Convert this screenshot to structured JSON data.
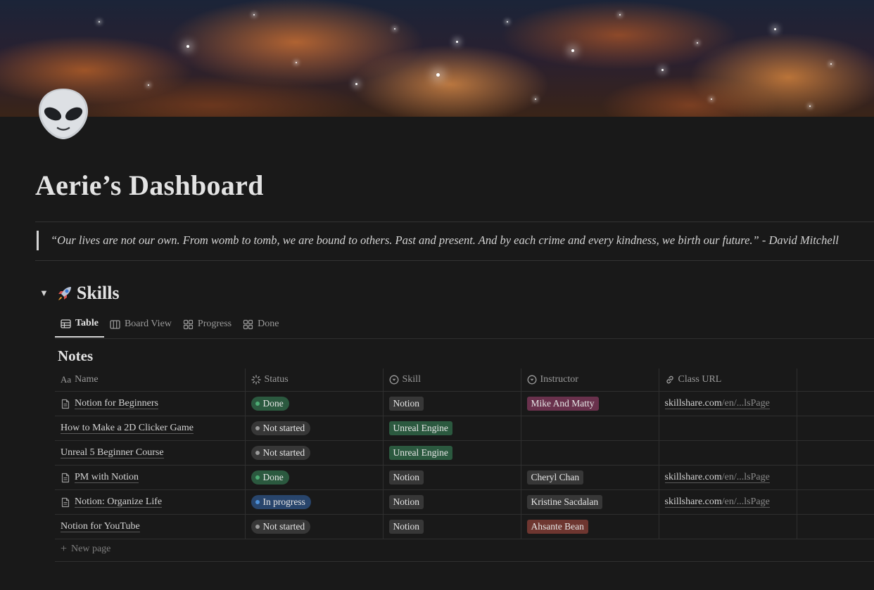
{
  "page": {
    "title": "Aerie’s Dashboard",
    "quote": "“Our lives are not our own.  From womb to tomb, we are bound to others.  Past and present.  And by each crime and every kindness, we birth our future.” - David Mitchell"
  },
  "section": {
    "title": "Skills",
    "icon": "rocket-icon"
  },
  "tabs": [
    {
      "label": "Table",
      "icon": "table-icon"
    },
    {
      "label": "Board View",
      "icon": "board-icon"
    },
    {
      "label": "Progress",
      "icon": "gallery-icon"
    },
    {
      "label": "Done",
      "icon": "gallery-icon"
    }
  ],
  "database": {
    "title": "Notes",
    "columns": [
      {
        "label": "Name",
        "icon": "text-aa-icon"
      },
      {
        "label": "Status",
        "icon": "status-icon"
      },
      {
        "label": "Skill",
        "icon": "select-icon"
      },
      {
        "label": "Instructor",
        "icon": "select-icon"
      },
      {
        "label": "Class URL",
        "icon": "link-icon"
      }
    ],
    "rows": [
      {
        "name": "Notion for Beginners",
        "has_page_icon": true,
        "status": "Done",
        "skill": "Notion",
        "instructor": "Mike And Matty",
        "url_domain": "skillshare.com",
        "url_path": "/en/...lsPage"
      },
      {
        "name": "How to Make a 2D Clicker Game",
        "has_page_icon": false,
        "status": "Not started",
        "skill": "Unreal Engine",
        "instructor": "",
        "url_domain": "",
        "url_path": ""
      },
      {
        "name": "Unreal 5 Beginner Course",
        "has_page_icon": false,
        "status": "Not started",
        "skill": "Unreal Engine",
        "instructor": "",
        "url_domain": "",
        "url_path": ""
      },
      {
        "name": "PM with Notion",
        "has_page_icon": true,
        "status": "Done",
        "skill": "Notion",
        "instructor": "Cheryl Chan",
        "url_domain": "skillshare.com",
        "url_path": "/en/...lsPage"
      },
      {
        "name": "Notion: Organize Life",
        "has_page_icon": true,
        "status": "In progress",
        "skill": "Notion",
        "instructor": "Kristine Sacdalan",
        "url_domain": "skillshare.com",
        "url_path": "/en/...lsPage"
      },
      {
        "name": "Notion for YouTube",
        "has_page_icon": false,
        "status": "Not started",
        "skill": "Notion",
        "instructor": "Ahsante Bean",
        "url_domain": "",
        "url_path": ""
      }
    ],
    "new_page_label": "New page"
  },
  "colors": {
    "status": {
      "Done": {
        "bg": "#2b593f",
        "dot": "#4dab74"
      },
      "Not started": {
        "bg": "#373737",
        "dot": "#9b9b9b"
      },
      "In progress": {
        "bg": "#28456c",
        "dot": "#4d8fd6"
      }
    },
    "skill": {
      "Notion": "#373737",
      "Unreal Engine": "#2b593f"
    },
    "instructor": {
      "Mike And Matty": "#69314c",
      "Cheryl Chan": "#373737",
      "Kristine Sacdalan": "#373737",
      "Ahsante Bean": "#6e3630"
    }
  }
}
